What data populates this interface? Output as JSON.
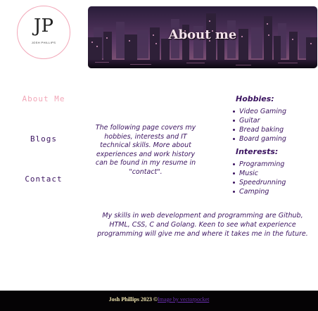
{
  "logo": {
    "mark": "JP",
    "name": "JOSH PHILLIPS"
  },
  "banner": {
    "title": "About me"
  },
  "nav": {
    "items": [
      {
        "label": "About Me",
        "active": true
      },
      {
        "label": "Blogs",
        "active": false
      },
      {
        "label": "Contact",
        "active": false
      }
    ]
  },
  "intro": {
    "text": "The following page covers my hobbies, interests and IT technical skills. More about experiences and work history can be found in my resume in \"contact\"."
  },
  "hobbies": {
    "heading": "Hobbies:",
    "items": [
      "Video Gaming",
      "Guitar",
      "Bread baking",
      "Board gaming"
    ]
  },
  "interests": {
    "heading": "Interests:",
    "items": [
      "Programming",
      "Music",
      "Speedrunning",
      "Camping"
    ]
  },
  "skills": {
    "text": "My skills in web development and programming are Github, HTML, CSS, C and Golang. Keen to see what experience programming will give me and where it takes me in the future."
  },
  "footer": {
    "copyright": "Josh Phillips 2023 ©",
    "credit_link": "Image by vectorpocket"
  },
  "colors": {
    "accent_pink": "#f2a7b8",
    "text_purple": "#3b1460",
    "footer_bg": "#050305"
  }
}
